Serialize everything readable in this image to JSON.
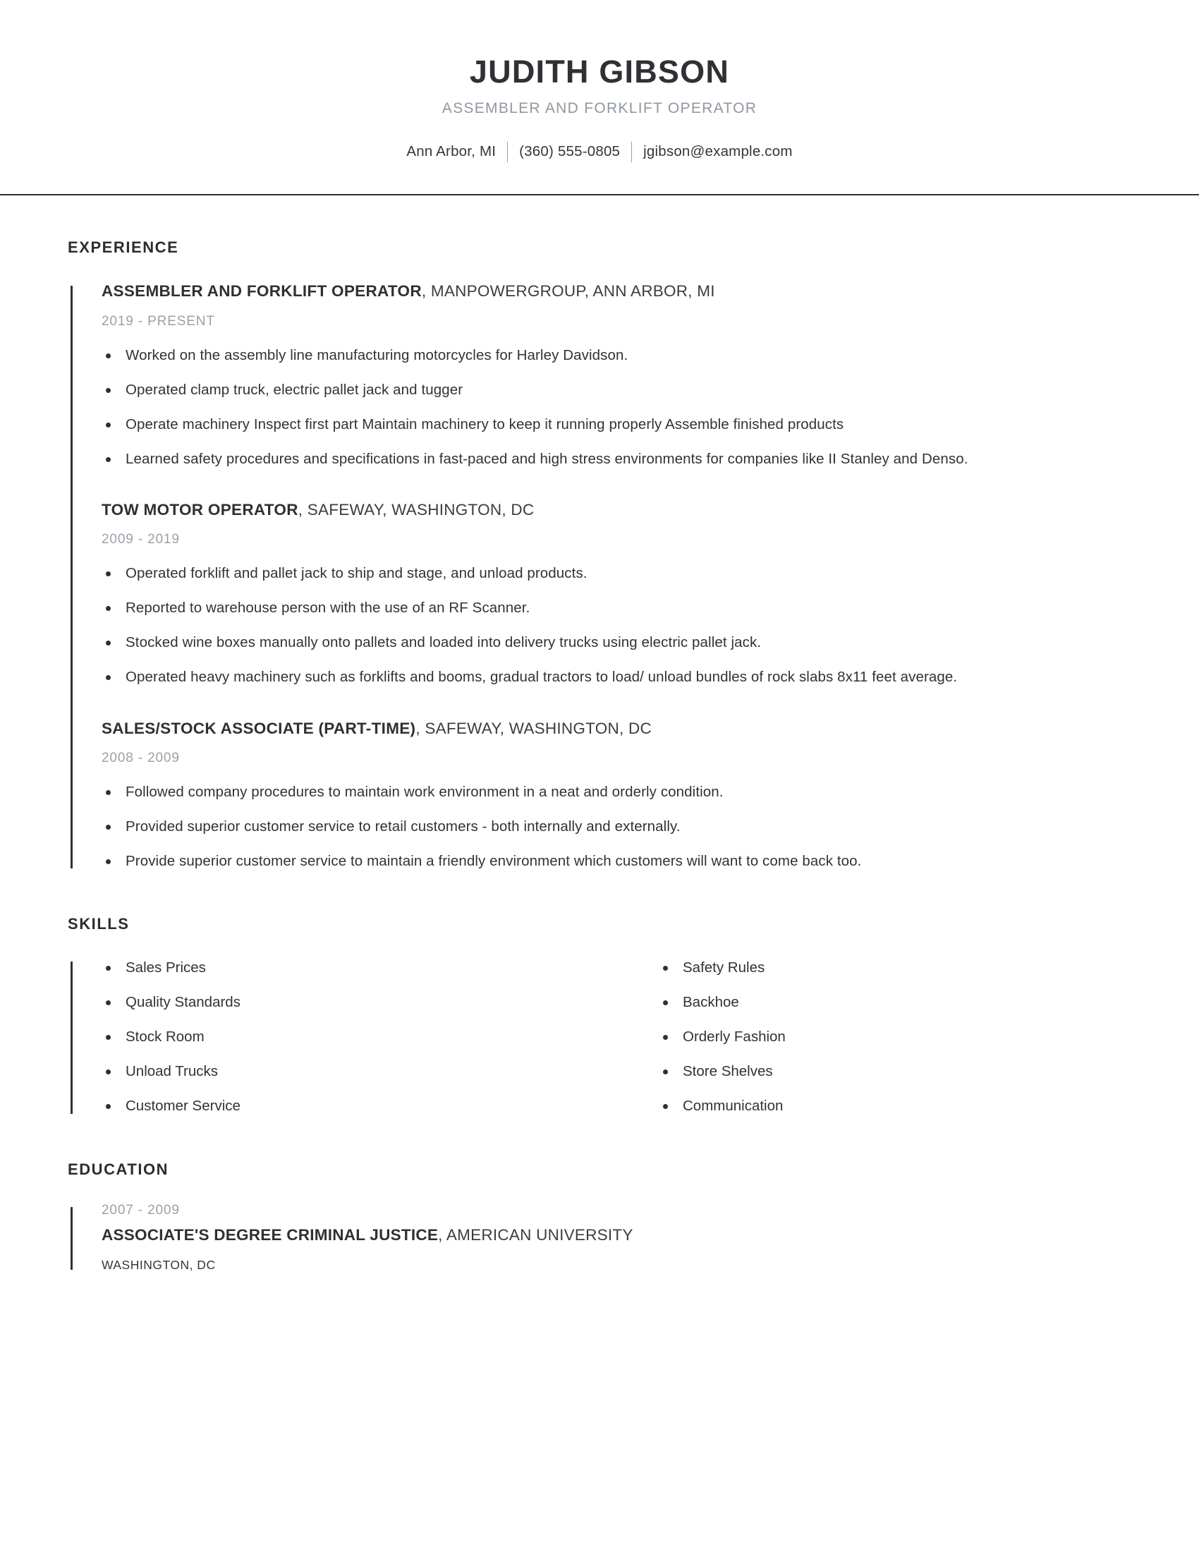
{
  "header": {
    "name": "JUDITH GIBSON",
    "headline": "ASSEMBLER AND FORKLIFT OPERATOR",
    "contact": {
      "location": "Ann Arbor, MI",
      "phone": "(360) 555-0805",
      "email": "jgibson@example.com"
    }
  },
  "sections": {
    "experience": {
      "title": "EXPERIENCE",
      "jobs": [
        {
          "role": "ASSEMBLER AND FORKLIFT OPERATOR",
          "org": ", MANPOWERGROUP, ANN ARBOR, MI",
          "dates": "2019 - PRESENT",
          "bullets": [
            "Worked on the assembly line manufacturing motorcycles for Harley Davidson.",
            "Operated clamp truck, electric pallet jack and tugger",
            "Operate machinery Inspect first part Maintain machinery to keep it running properly Assemble finished products",
            "Learned safety procedures and specifications in fast-paced and high stress environments for companies like II Stanley and Denso."
          ]
        },
        {
          "role": "TOW MOTOR OPERATOR",
          "org": ", SAFEWAY, WASHINGTON, DC",
          "dates": "2009 - 2019",
          "bullets": [
            "Operated forklift and pallet jack to ship and stage, and unload products.",
            "Reported to warehouse person with the use of an RF Scanner.",
            "Stocked wine boxes manually onto pallets and loaded into delivery trucks using electric pallet jack.",
            "Operated heavy machinery such as forklifts and booms, gradual tractors to load/ unload bundles of rock slabs 8x11 feet average."
          ]
        },
        {
          "role": "SALES/STOCK ASSOCIATE (PART-TIME)",
          "org": ", SAFEWAY, WASHINGTON, DC",
          "dates": "2008 - 2009",
          "bullets": [
            "Followed company procedures to maintain work environment in a neat and orderly condition.",
            "Provided superior customer service to retail customers - both internally and externally.",
            "Provide superior customer service to maintain a friendly environment which customers will want to come back too."
          ]
        }
      ]
    },
    "skills": {
      "title": "SKILLS",
      "column_left": [
        "Sales Prices",
        "Quality Standards",
        "Stock Room",
        "Unload Trucks",
        "Customer Service"
      ],
      "column_right": [
        "Safety Rules",
        "Backhoe",
        "Orderly Fashion",
        "Store Shelves",
        "Communication"
      ]
    },
    "education": {
      "title": "EDUCATION",
      "entries": [
        {
          "dates": "2007 - 2009",
          "degree": "ASSOCIATE'S DEGREE CRIMINAL JUSTICE",
          "school": ", AMERICAN UNIVERSITY",
          "location": "WASHINGTON, DC"
        }
      ]
    }
  },
  "colors": {
    "text_primary": "#2e3033",
    "text_muted": "#9ba1a9",
    "rule": "#2e3033"
  }
}
